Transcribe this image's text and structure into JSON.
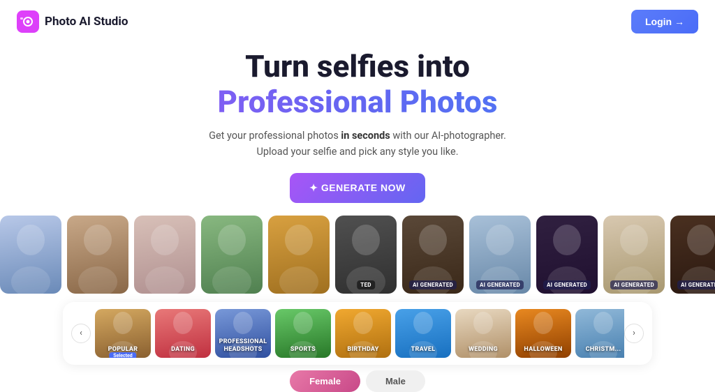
{
  "header": {
    "logo_text": "Photo AI Studio",
    "logo_tm": "™",
    "login_label": "Login →"
  },
  "hero": {
    "title_line1": "Turn selfies into",
    "title_line2": "Professional Photos",
    "subtitle_line1": "Get your professional photos in seconds with our AI-photographer.",
    "subtitle_line2": "Upload your selfie and pick any style you like.",
    "subtitle_bold": "in seconds",
    "generate_label": "✦ GENERATE NOW"
  },
  "photos": [
    {
      "id": 1,
      "class": "person-1",
      "label": null
    },
    {
      "id": 2,
      "class": "person-2",
      "label": null
    },
    {
      "id": 3,
      "class": "person-3",
      "label": null
    },
    {
      "id": 4,
      "class": "person-4",
      "label": null
    },
    {
      "id": 5,
      "class": "person-5",
      "label": null
    },
    {
      "id": 6,
      "class": "person-6",
      "label": "TED"
    },
    {
      "id": 7,
      "class": "person-7",
      "label": "AI GENERATED"
    },
    {
      "id": 8,
      "class": "person-8",
      "label": "AI GENERATED"
    },
    {
      "id": 9,
      "class": "person-9",
      "label": "AI GENERATED"
    },
    {
      "id": 10,
      "class": "person-10",
      "label": "AI GENERATED"
    },
    {
      "id": 11,
      "class": "person-11",
      "label": "AI GENERATED"
    }
  ],
  "categories": [
    {
      "id": "popular",
      "label": "POPULAR",
      "class": "cat-popular",
      "selected": true
    },
    {
      "id": "dating",
      "label": "DATING",
      "class": "cat-dating",
      "selected": false
    },
    {
      "id": "professional",
      "label": "PROFESSIONAL HEADSHOTS",
      "class": "cat-professional",
      "selected": false
    },
    {
      "id": "sports",
      "label": "SPORTS",
      "class": "cat-sports",
      "selected": false
    },
    {
      "id": "birthday",
      "label": "BIRTHDAY",
      "class": "cat-birthday",
      "selected": false
    },
    {
      "id": "travel",
      "label": "TRAVEL",
      "class": "cat-travel",
      "selected": false
    },
    {
      "id": "wedding",
      "label": "WEDDING",
      "class": "cat-wedding",
      "selected": false
    },
    {
      "id": "halloween",
      "label": "HALLOWEEN",
      "class": "cat-halloween",
      "selected": false
    },
    {
      "id": "christmas",
      "label": "CHRISTM...",
      "class": "cat-christmas",
      "selected": false
    }
  ],
  "gender": {
    "female_label": "Female",
    "male_label": "Male"
  },
  "icons": {
    "arrow_left": "‹",
    "arrow_right": "›",
    "camera_icon": "📷",
    "wand_icon": "✦"
  }
}
